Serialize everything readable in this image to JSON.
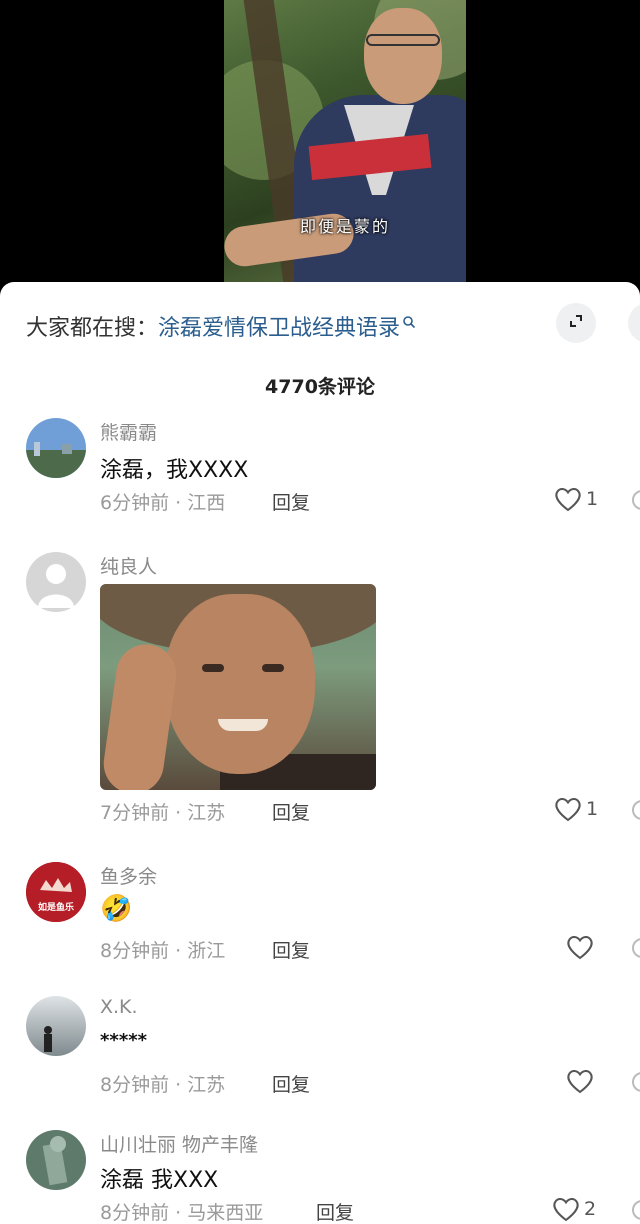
{
  "video": {
    "subtitle": "即便是蒙的"
  },
  "search": {
    "prefix": "大家都在搜：",
    "query": "涂磊爱情保卫战经典语录"
  },
  "comments_header": {
    "count_label": "4770条评论"
  },
  "reply_label": "回复",
  "comments": [
    {
      "username": "熊霸霸",
      "text": "涂磊，我XXXX",
      "time_location": "6分钟前 · 江西",
      "likes": "1",
      "avatar": "sky-landscape"
    },
    {
      "username": "纯良人",
      "text": "",
      "time_location": "7分钟前 · 江苏",
      "likes": "1",
      "avatar": "default-person",
      "has_image": true
    },
    {
      "username": "鱼多余",
      "text": "🤣",
      "time_location": "8分钟前 · 浙江",
      "likes": "",
      "avatar": "red-logo",
      "avatar_text": "如是鱼乐"
    },
    {
      "username": "X.K.",
      "text": "*****",
      "time_location": "8分钟前 · 江苏",
      "likes": "",
      "avatar": "silhouette"
    },
    {
      "username": "山川壮丽 物产丰隆",
      "text": "涂磊 我XXX",
      "time_location": "8分钟前 · 马来西亚",
      "likes": "2",
      "avatar": "green-statue"
    }
  ],
  "colors": {
    "link": "#2b5e8e",
    "muted": "#8a8a8a",
    "sheet_bg": "#ffffff"
  }
}
